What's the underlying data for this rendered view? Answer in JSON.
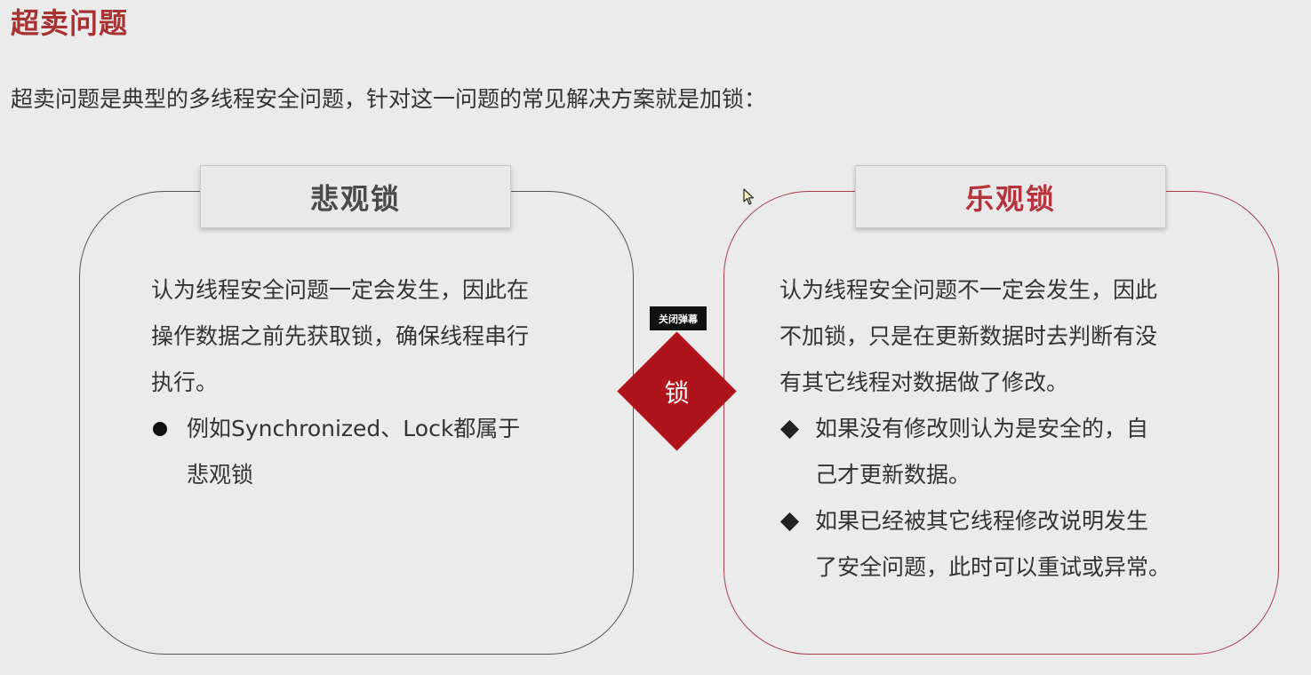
{
  "title": "超卖问题",
  "intro": "超卖问题是典型的多线程安全问题，针对这一问题的常见解决方案就是加锁：",
  "pessimistic": {
    "label": "悲观锁",
    "lines": [
      "认为线程安全问题一定会发生，因此在",
      "操作数据之前先获取锁，确保线程串行",
      "执行。"
    ],
    "bullet": {
      "line1": "例如Synchronized、Lock都属于",
      "line2": "悲观锁"
    }
  },
  "optimistic": {
    "label": "乐观锁",
    "lines": [
      "认为线程安全问题不一定会发生，因此",
      "不加锁，只是在更新数据时去判断有没",
      "有其它线程对数据做了修改。"
    ],
    "bullets": [
      {
        "line1": "如果没有修改则认为是安全的，自",
        "line2": "己才更新数据。"
      },
      {
        "line1": "如果已经被其它线程修改说明发生",
        "line2": "了安全问题，此时可以重试或异常。"
      }
    ]
  },
  "center": {
    "lock_label": "锁",
    "popup_label": "关闭弹幕"
  },
  "colors": {
    "title": "#a83232",
    "optimistic_label": "#b5343e",
    "lock_diamond": "#b0141b",
    "background": "#ebebeb"
  },
  "icons": {
    "bullet_left": "filled-circle",
    "bullet_right": "filled-diamond",
    "cursor": "mouse-pointer-icon"
  }
}
